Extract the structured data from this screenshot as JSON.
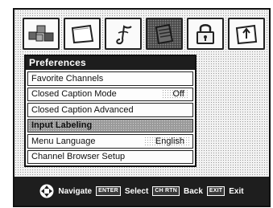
{
  "icon_tabs": [
    {
      "name": "picture-icon"
    },
    {
      "name": "screen-icon"
    },
    {
      "name": "audio-note-icon"
    },
    {
      "name": "preferences-icon"
    },
    {
      "name": "lock-icon"
    },
    {
      "name": "setup-icon"
    }
  ],
  "menu": {
    "title": "Preferences",
    "items": [
      {
        "label": "Favorite Channels",
        "value": ""
      },
      {
        "label": "Closed Caption Mode",
        "value": "Off"
      },
      {
        "label": "Closed Caption Advanced",
        "value": ""
      },
      {
        "label": "Input Labeling",
        "value": ""
      },
      {
        "label": "Menu Language",
        "value": "English"
      },
      {
        "label": "Channel Browser Setup",
        "value": ""
      }
    ],
    "selected_index": 3
  },
  "helpbar": {
    "navigate": "Navigate",
    "enter_key": "ENTER",
    "select": "Select",
    "chrtn_key": "CH RTN",
    "back": "Back",
    "exit_key": "EXIT",
    "exit": "Exit"
  }
}
